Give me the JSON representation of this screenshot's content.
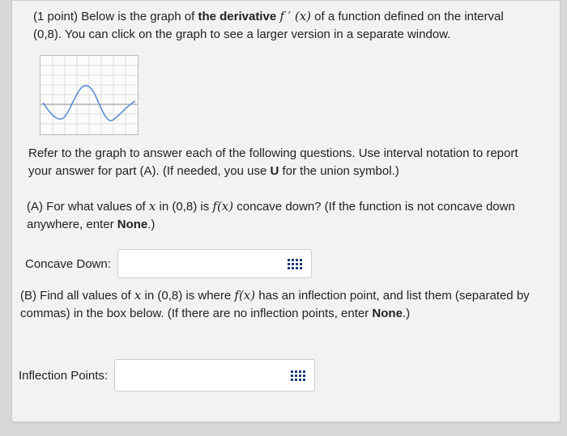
{
  "intro": {
    "text_1": "(1 point) Below is the graph of ",
    "bold": "the derivative",
    "fprime": "f ′ (x)",
    "text_2": " of a function defined on the interval (0,8). You can click on the graph to see a larger version in a separate window."
  },
  "graph": {
    "icon": "derivative-graph-thumbnail",
    "line_color": "#5b8fd6"
  },
  "refer": {
    "text_1": "Refer to the graph to answer each of the following questions. Use interval notation to report your answer for part (A). (If needed, you use ",
    "bold_u": "U",
    "text_2": " for the union symbol.)"
  },
  "partA": {
    "text_1": "(A) For what values of ",
    "x": "x",
    "text_2": " in (0,8) is ",
    "fx": "f(x)",
    "text_3": " concave down? (If the function is not concave down anywhere, enter ",
    "none": "None",
    "text_4": ".)",
    "label": "Concave Down:",
    "input_value": "",
    "keyboard_icon": "keyboard-icon"
  },
  "partB": {
    "text_1": "(B) Find all values of ",
    "x": "x",
    "text_2": " in (0,8) is where ",
    "fx": "f(x)",
    "text_3": " has an inflection point, and list them (separated by commas) in the box below. (If there are no inflection points, enter ",
    "none": "None",
    "text_4": ".)",
    "label": "Inflection Points:",
    "input_value": "",
    "keyboard_icon": "keyboard-icon"
  }
}
